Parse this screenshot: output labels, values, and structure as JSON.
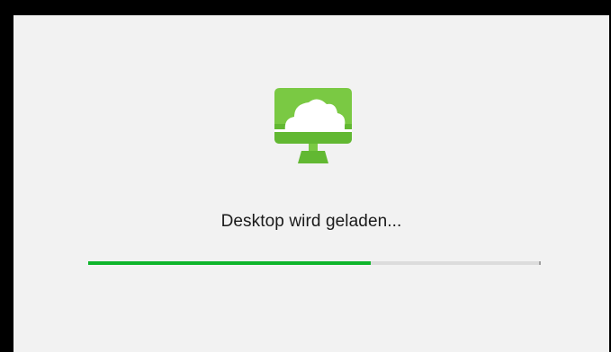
{
  "loading_screen": {
    "status_text": "Desktop wird geladen...",
    "progress": 0.625,
    "logo_icon": "cloud-desktop-icon",
    "colors": {
      "accent": "#0fb52b",
      "logo_green": "#7ac943",
      "track": "#dcdcdc",
      "background": "#f2f2f2"
    }
  }
}
